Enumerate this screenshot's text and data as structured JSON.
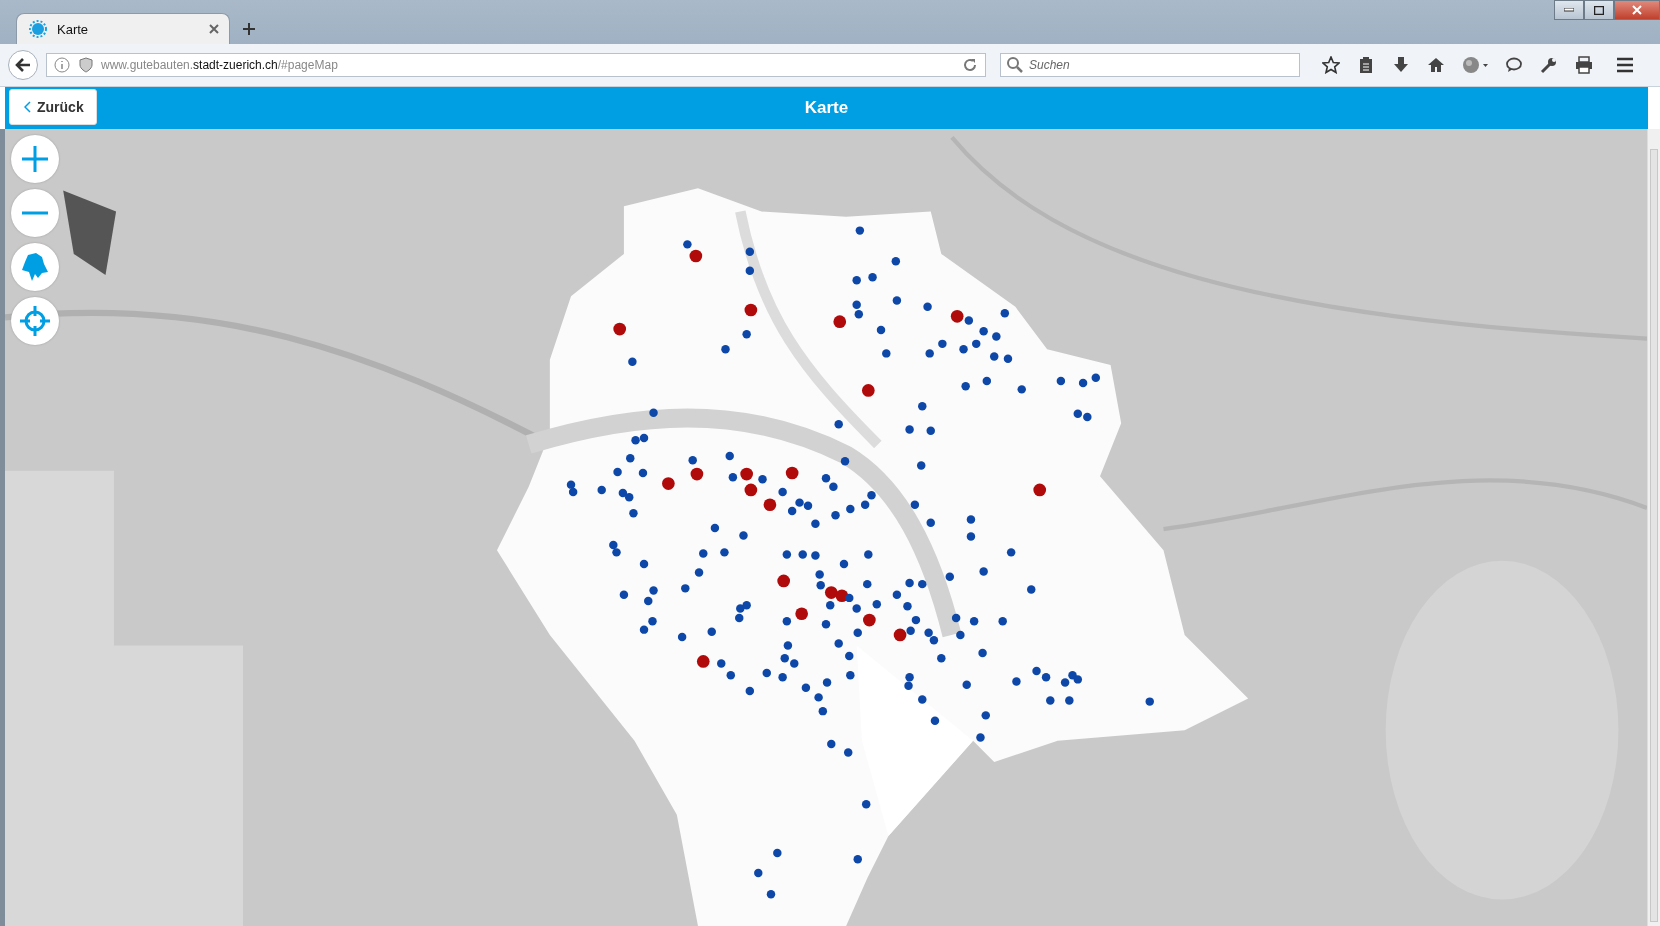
{
  "browser": {
    "tab": {
      "title": "Karte",
      "selected": true
    },
    "url": "www.gutebauten.**stadt-zuerich.ch**/#pageMap",
    "search": {
      "placeholder": "Suchen"
    }
  },
  "header": {
    "back_button": "Zurück",
    "title": "Karte"
  },
  "markers": [
    {
      "color": "#b00a0a"
    },
    {
      "color": "#b00a0a"
    },
    {
      "color": "#b00a0a"
    },
    {
      "color": "#b00a0a"
    },
    {
      "color": "#b00a0a"
    },
    {
      "color": "#b00a0a"
    },
    {
      "color": "#b00a0a"
    },
    {
      "color": "#b00a0a"
    },
    {
      "color": "#b00a0a"
    },
    {
      "color": "#b00a0a"
    },
    {
      "color": "#b00a0a"
    },
    {
      "color": "#b00a0a"
    },
    {
      "color": "#b00a0a"
    },
    {
      "color": "#b00a0a"
    },
    {
      "color": "#b00a0a"
    },
    {
      "color": "#b00a0a"
    },
    {
      "color": "#b00a0a"
    },
    {
      "color": "#b00a0a"
    },
    {
      "color": "#b00a0a"
    },
    {
      "color": "#b00a0a"
    },
    {
      "color": "#0d47a8"
    },
    {
      "color": "#0d47a8"
    },
    {
      "color": "#0d47a8"
    },
    {
      "color": "#0d47a8"
    },
    {
      "color": "#0d47a8"
    },
    {
      "color": "#0d47a8"
    },
    {
      "color": "#0d47a8"
    },
    {
      "color": "#0d47a8"
    },
    {
      "color": "#0d47a8"
    },
    {
      "color": "#0d47a8"
    },
    {
      "color": "#0d47a8"
    },
    {
      "color": "#0d47a8"
    },
    {
      "color": "#0d47a8"
    },
    {
      "color": "#0d47a8"
    },
    {
      "color": "#0d47a8"
    },
    {
      "color": "#0d47a8"
    },
    {
      "color": "#0d47a8"
    },
    {
      "color": "#0d47a8"
    },
    {
      "color": "#0d47a8"
    },
    {
      "color": "#0d47a8"
    },
    {
      "color": "#0d47a8"
    },
    {
      "color": "#0d47a8"
    },
    {
      "color": "#0d47a8"
    },
    {
      "color": "#0d47a8"
    },
    {
      "color": "#0d47a8"
    },
    {
      "color": "#0d47a8"
    },
    {
      "color": "#0d47a8"
    },
    {
      "color": "#0d47a8"
    },
    {
      "color": "#0d47a8"
    },
    {
      "color": "#0d47a8"
    },
    {
      "color": "#0d47a8"
    },
    {
      "color": "#0d47a8"
    },
    {
      "color": "#0d47a8"
    },
    {
      "color": "#0d47a8"
    },
    {
      "color": "#0d47a8"
    },
    {
      "color": "#0d47a8"
    },
    {
      "color": "#0d47a8"
    },
    {
      "color": "#0d47a8"
    },
    {
      "color": "#0d47a8"
    },
    {
      "color": "#0d47a8"
    },
    {
      "color": "#0d47a8"
    },
    {
      "color": "#0d47a8"
    },
    {
      "color": "#0d47a8"
    },
    {
      "color": "#0d47a8"
    },
    {
      "color": "#0d47a8"
    },
    {
      "color": "#0d47a8"
    },
    {
      "color": "#0d47a8"
    },
    {
      "color": "#0d47a8"
    },
    {
      "color": "#0d47a8"
    },
    {
      "color": "#0d47a8"
    },
    {
      "color": "#0d47a8"
    },
    {
      "color": "#0d47a8"
    },
    {
      "color": "#0d47a8"
    },
    {
      "color": "#0d47a8"
    },
    {
      "color": "#0d47a8"
    },
    {
      "color": "#0d47a8"
    },
    {
      "color": "#0d47a8"
    },
    {
      "color": "#0d47a8"
    },
    {
      "color": "#0d47a8"
    },
    {
      "color": "#0d47a8"
    },
    {
      "color": "#0d47a8"
    },
    {
      "color": "#0d47a8"
    },
    {
      "color": "#0d47a8"
    },
    {
      "color": "#0d47a8"
    },
    {
      "color": "#0d47a8"
    },
    {
      "color": "#0d47a8"
    },
    {
      "color": "#0d47a8"
    },
    {
      "color": "#0d47a8"
    },
    {
      "color": "#0d47a8"
    },
    {
      "color": "#0d47a8"
    },
    {
      "color": "#0d47a8"
    },
    {
      "color": "#0d47a8"
    },
    {
      "color": "#0d47a8"
    },
    {
      "color": "#0d47a8"
    },
    {
      "color": "#0d47a8"
    },
    {
      "color": "#0d47a8"
    },
    {
      "color": "#0d47a8"
    },
    {
      "color": "#0d47a8"
    },
    {
      "color": "#0d47a8"
    },
    {
      "color": "#0d47a8"
    },
    {
      "color": "#0d47a8"
    },
    {
      "color": "#0d47a8"
    },
    {
      "color": "#0d47a8"
    },
    {
      "color": "#0d47a8"
    },
    {
      "color": "#0d47a8"
    },
    {
      "color": "#0d47a8"
    },
    {
      "color": "#0d47a8"
    },
    {
      "color": "#0d47a8"
    },
    {
      "color": "#0d47a8"
    },
    {
      "color": "#0d47a8"
    },
    {
      "color": "#0d47a8"
    },
    {
      "color": "#0d47a8"
    },
    {
      "color": "#0d47a8"
    },
    {
      "color": "#0d47a8"
    },
    {
      "color": "#0d47a8"
    },
    {
      "color": "#0d47a8"
    },
    {
      "color": "#0d47a8"
    },
    {
      "color": "#0d47a8"
    },
    {
      "color": "#0d47a8"
    },
    {
      "color": "#0d47a8"
    },
    {
      "color": "#0d47a8"
    },
    {
      "color": "#0d47a8"
    },
    {
      "color": "#0d47a8"
    },
    {
      "color": "#0d47a8"
    },
    {
      "color": "#0d47a8"
    },
    {
      "color": "#0d47a8"
    },
    {
      "color": "#0d47a8"
    },
    {
      "color": "#0d47a8"
    },
    {
      "color": "#0d47a8"
    },
    {
      "color": "#0d47a8"
    },
    {
      "color": "#0d47a8"
    },
    {
      "color": "#0d47a8"
    },
    {
      "color": "#0d47a8"
    },
    {
      "color": "#0d47a8"
    },
    {
      "color": "#0d47a8"
    },
    {
      "color": "#0d47a8"
    },
    {
      "color": "#0d47a8"
    },
    {
      "color": "#0d47a8"
    },
    {
      "color": "#0d47a8"
    },
    {
      "color": "#0d47a8"
    },
    {
      "color": "#0d47a8"
    },
    {
      "color": "#0d47a8"
    },
    {
      "color": "#0d47a8"
    },
    {
      "color": "#0d47a8"
    },
    {
      "color": "#0d47a8"
    },
    {
      "color": "#0d47a8"
    },
    {
      "color": "#0d47a8"
    },
    {
      "color": "#0d47a8"
    },
    {
      "color": "#0d47a8"
    },
    {
      "color": "#0d47a8"
    },
    {
      "color": "#0d47a8"
    },
    {
      "color": "#0d47a8"
    },
    {
      "color": "#0d47a8"
    },
    {
      "color": "#0d47a8"
    },
    {
      "color": "#0d47a8"
    },
    {
      "color": "#0d47a8"
    },
    {
      "color": "#0d47a8"
    },
    {
      "color": "#0d47a8"
    },
    {
      "color": "#0d47a8"
    },
    {
      "color": "#0d47a8"
    },
    {
      "color": "#0d47a8"
    },
    {
      "color": "#0d47a8"
    },
    {
      "color": "#0d47a8"
    },
    {
      "color": "#0d47a8"
    },
    {
      "color": "#0d47a8"
    },
    {
      "color": "#0d47a8"
    },
    {
      "color": "#0d47a8"
    },
    {
      "color": "#0d47a8"
    },
    {
      "color": "#0d47a8"
    },
    {
      "color": "#0d47a8"
    },
    {
      "color": "#0d47a8"
    },
    {
      "color": "#0d47a8"
    },
    {
      "color": "#0d47a8"
    },
    {
      "color": "#0d47a8"
    },
    {
      "color": "#0d47a8"
    },
    {
      "color": "#0d47a8"
    },
    {
      "color": "#0d47a8"
    },
    {
      "color": "#0d47a8"
    },
    {
      "color": "#0d47a8"
    },
    {
      "color": "#0d47a8"
    },
    {
      "color": "#0d47a8"
    }
  ]
}
